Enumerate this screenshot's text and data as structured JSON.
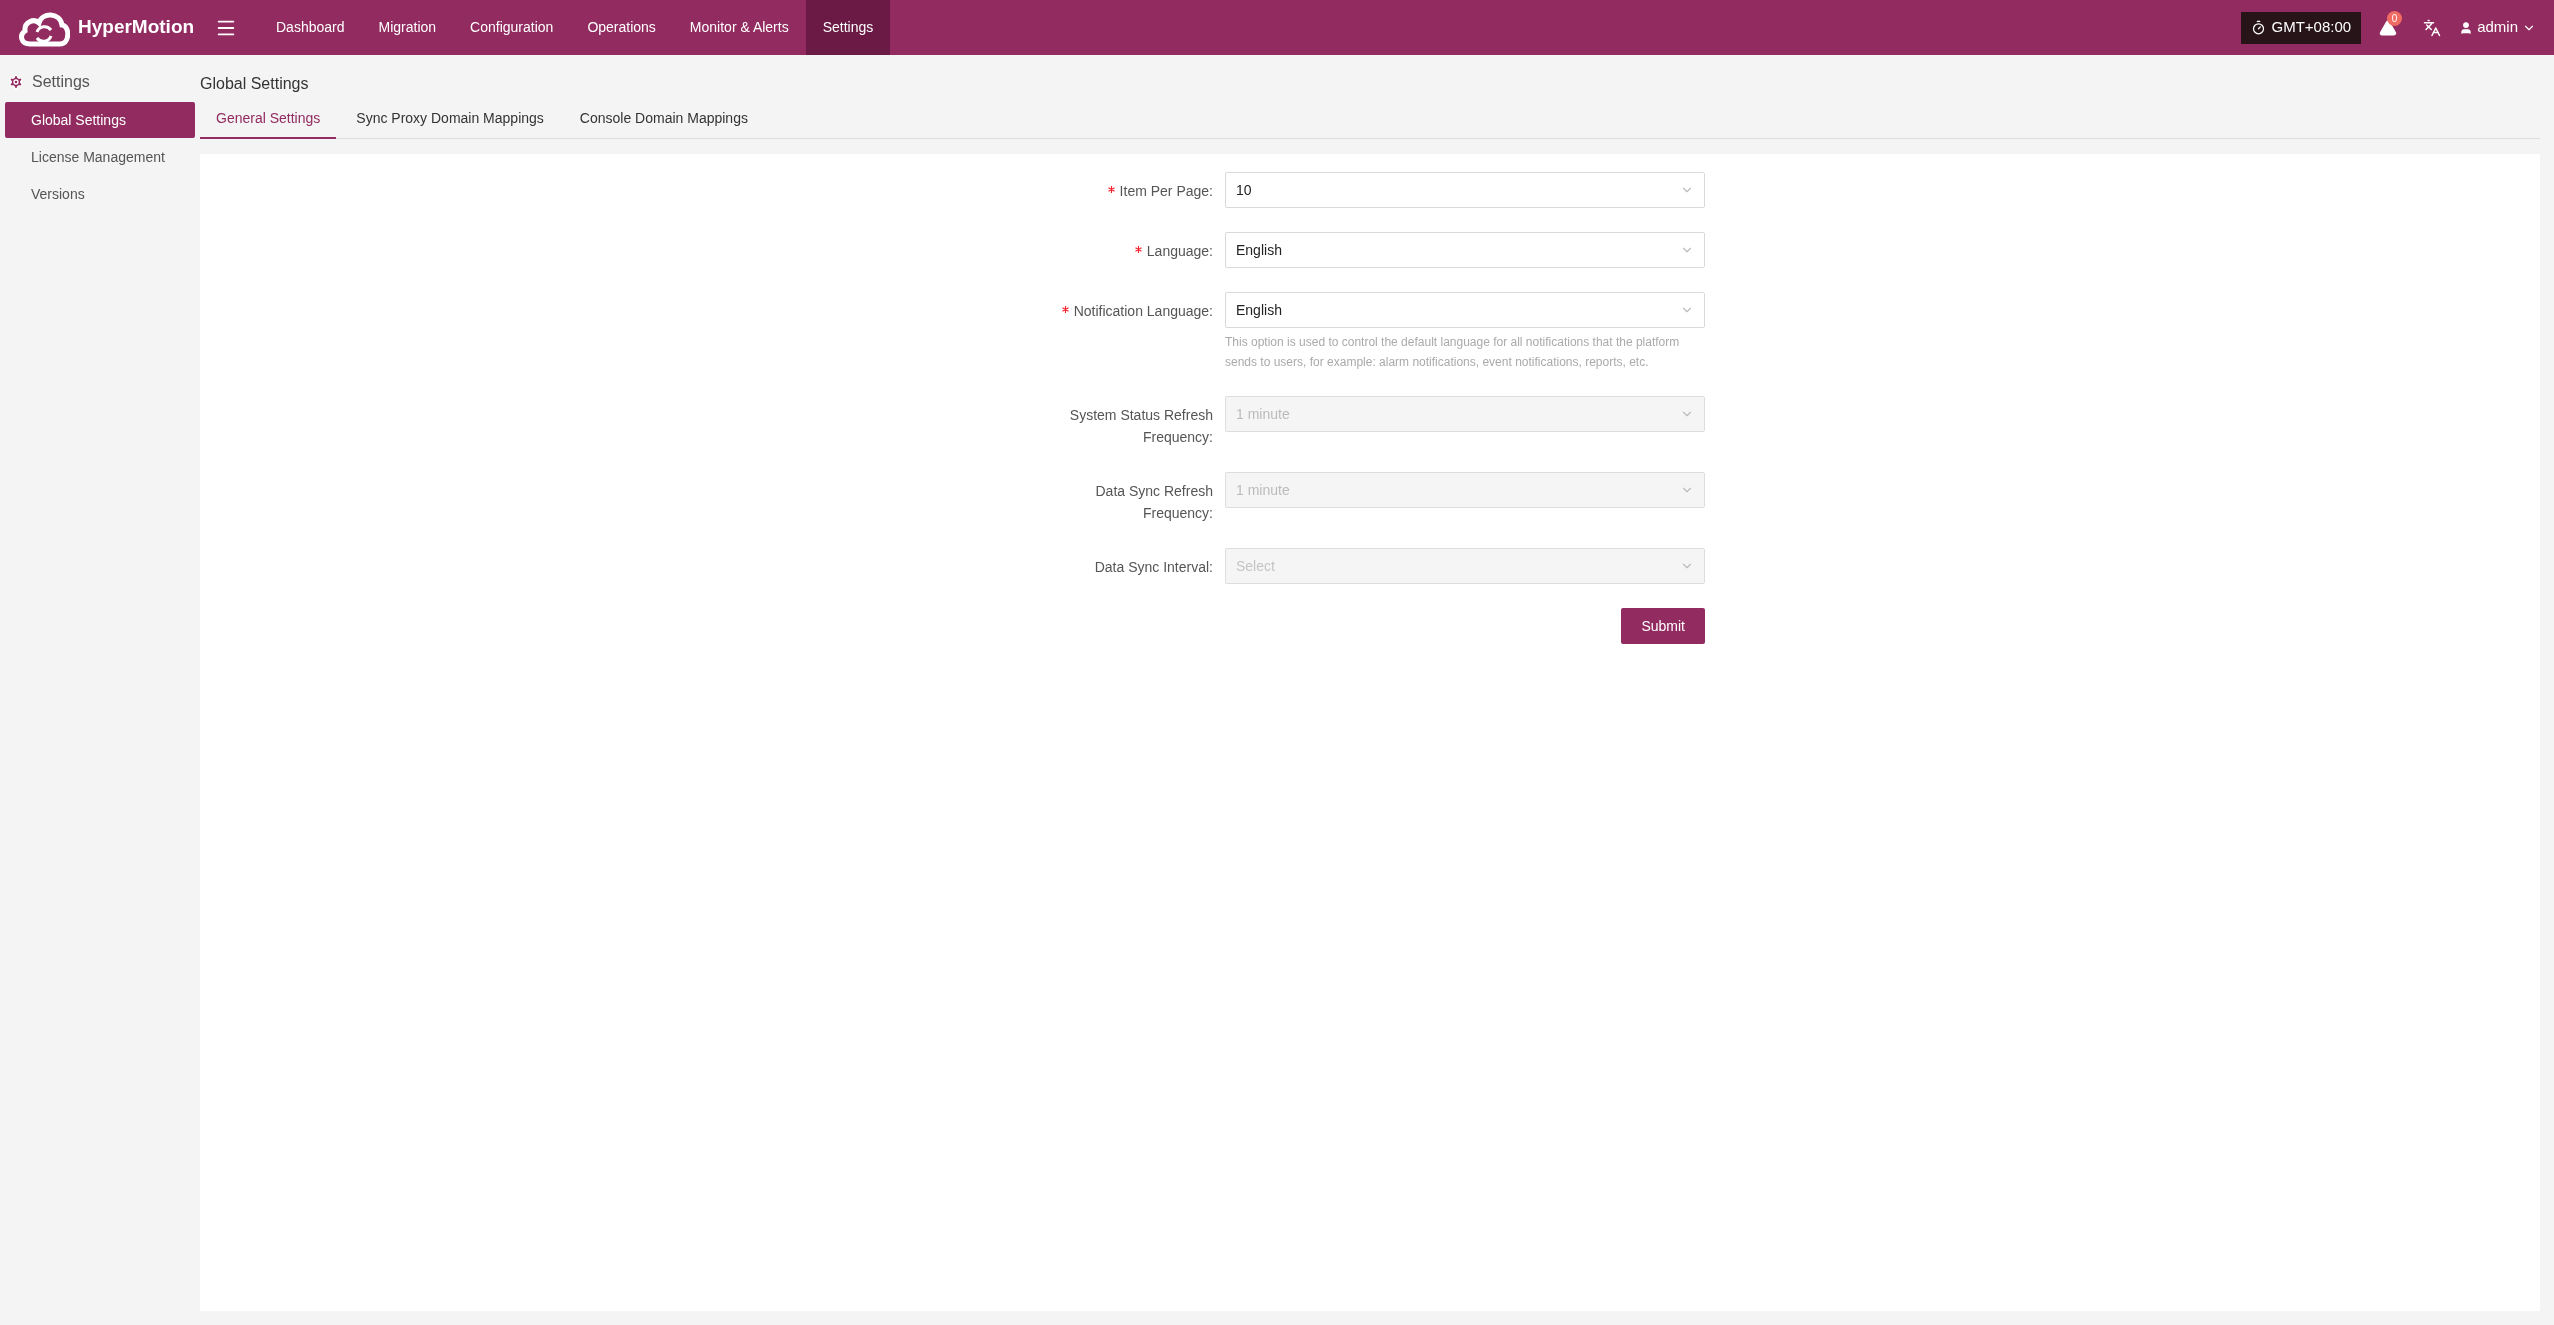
{
  "header": {
    "brand": "HyperMotion",
    "nav": [
      {
        "label": "Dashboard",
        "selected": false
      },
      {
        "label": "Migration",
        "selected": false
      },
      {
        "label": "Configuration",
        "selected": false
      },
      {
        "label": "Operations",
        "selected": false
      },
      {
        "label": "Monitor & Alerts",
        "selected": false
      },
      {
        "label": "Settings",
        "selected": true
      }
    ],
    "timezone": "GMT+08:00",
    "alert_count": "0",
    "user": "admin"
  },
  "sidebar": {
    "title": "Settings",
    "items": [
      {
        "label": "Global Settings",
        "selected": true
      },
      {
        "label": "License Management",
        "selected": false
      },
      {
        "label": "Versions",
        "selected": false
      }
    ]
  },
  "page": {
    "title": "Global Settings",
    "tabs": [
      {
        "label": "General Settings",
        "selected": true
      },
      {
        "label": "Sync Proxy Domain Mappings",
        "selected": false
      },
      {
        "label": "Console Domain Mappings",
        "selected": false
      }
    ]
  },
  "form": {
    "fields": [
      {
        "label": "Item Per Page:",
        "required": true,
        "disabled": false,
        "value": "10"
      },
      {
        "label": "Language:",
        "required": true,
        "disabled": false,
        "value": "English"
      },
      {
        "label": "Notification Language:",
        "required": true,
        "disabled": false,
        "value": "English",
        "help": "This option is used to control the default language for all notifications that the platform sends to users, for example: alarm notifications, event notifications, reports, etc."
      },
      {
        "label": "System Status Refresh Frequency:",
        "required": false,
        "disabled": true,
        "value": "1 minute"
      },
      {
        "label": "Data Sync Refresh Frequency:",
        "required": false,
        "disabled": true,
        "value": "1 minute"
      },
      {
        "label": "Data Sync Interval:",
        "required": false,
        "disabled": true,
        "placeholder": "Select"
      }
    ],
    "submit": "Submit"
  }
}
